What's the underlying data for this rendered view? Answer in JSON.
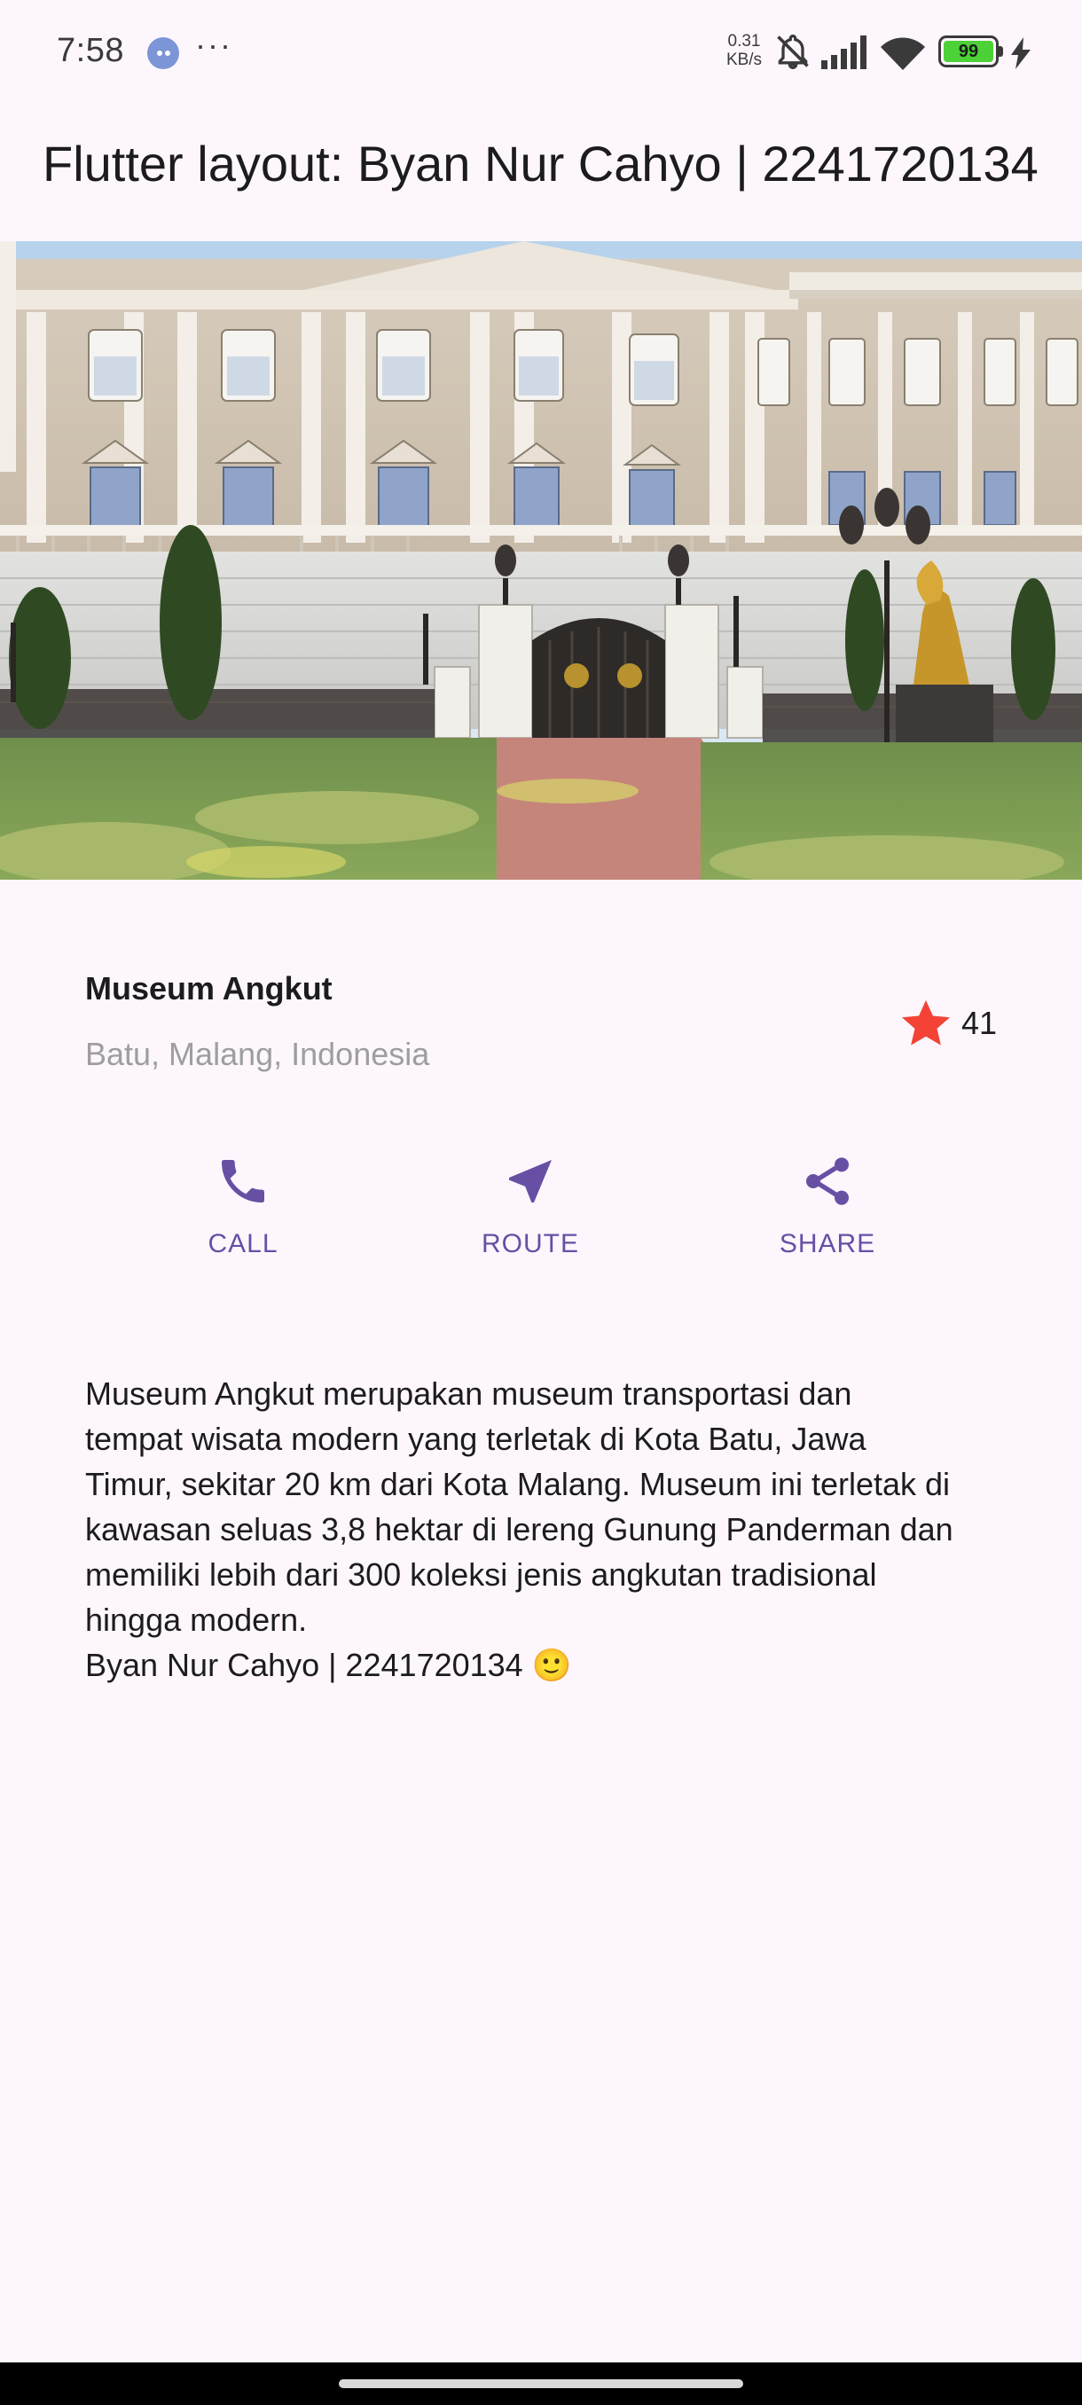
{
  "status_bar": {
    "time": "7:58",
    "more": "···",
    "speed": "0.31\nKB/s",
    "battery": "99",
    "icons": [
      "notification-icon",
      "muted-bell-icon",
      "signal-icon",
      "wifi-icon",
      "battery-icon",
      "charging-icon"
    ]
  },
  "app_bar": {
    "title": "Flutter layout: Byan Nur Cahyo | 2241720134"
  },
  "title_section": {
    "name": "Museum Angkut",
    "location": "Batu, Malang, Indonesia",
    "rating_count": "41",
    "star_color": "#f44336"
  },
  "buttons": [
    {
      "label": "CALL",
      "icon": "phone-icon"
    },
    {
      "label": "ROUTE",
      "icon": "near-me-icon"
    },
    {
      "label": "SHARE",
      "icon": "share-icon"
    }
  ],
  "accent_color": "#6750a4",
  "description": "Museum Angkut merupakan museum transportasi dan\ntempat wisata modern yang terletak di Kota Batu, Jawa\nTimur, sekitar 20 km dari Kota Malang. Museum ini terletak di\nkawasan seluas 3,8 hektar di lereng Gunung Panderman dan\nmemiliki lebih dari 300 koleksi jenis angkutan tradisional\nhingga modern.\nByan Nur Cahyo | 2241720134 🙂"
}
